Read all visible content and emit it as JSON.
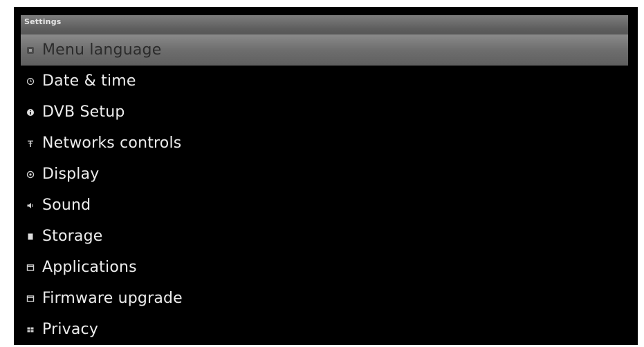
{
  "window": {
    "title": "Settings"
  },
  "menu": {
    "selected_index": 0,
    "items": [
      {
        "label": "Menu language",
        "icon": "language-icon"
      },
      {
        "label": "Date & time",
        "icon": "clock-icon"
      },
      {
        "label": "DVB Setup",
        "icon": "info-icon"
      },
      {
        "label": "Networks controls",
        "icon": "network-antenna-icon"
      },
      {
        "label": "Display",
        "icon": "display-icon"
      },
      {
        "label": "Sound",
        "icon": "speaker-icon"
      },
      {
        "label": "Storage",
        "icon": "storage-icon"
      },
      {
        "label": "Applications",
        "icon": "applications-icon"
      },
      {
        "label": "Firmware upgrade",
        "icon": "firmware-icon"
      },
      {
        "label": "Privacy",
        "icon": "privacy-icon"
      }
    ]
  },
  "colors": {
    "background": "#000000",
    "title_bar": "#6e6e6e",
    "selection": "#777777",
    "text": "#ececec"
  }
}
